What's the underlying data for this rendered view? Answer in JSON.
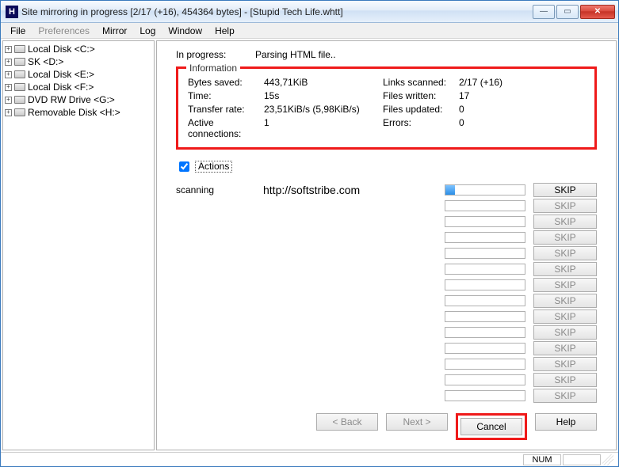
{
  "title": "Site mirroring in progress [2/17 (+16), 454364 bytes] - [Stupid Tech Life.whtt]",
  "app_icon_letter": "H",
  "menus": {
    "file": "File",
    "preferences": "Preferences",
    "mirror": "Mirror",
    "log": "Log",
    "window": "Window",
    "help": "Help"
  },
  "sidebar": {
    "items": [
      {
        "label": "Local Disk <C:>"
      },
      {
        "label": "SK <D:>"
      },
      {
        "label": "Local Disk <E:>"
      },
      {
        "label": "Local Disk <F:>"
      },
      {
        "label": "DVD RW Drive <G:>"
      },
      {
        "label": "Removable Disk <H:>"
      }
    ]
  },
  "progress": {
    "label": "In progress:",
    "value": "Parsing HTML file.."
  },
  "info": {
    "legend": "Information",
    "bytes_saved_label": "Bytes saved:",
    "bytes_saved": "443,71KiB",
    "time_label": "Time:",
    "time": "15s",
    "transfer_rate_label": "Transfer rate:",
    "transfer_rate": "23,51KiB/s (5,98KiB/s)",
    "active_conn_label": "Active connections:",
    "active_conn": "1",
    "links_scanned_label": "Links scanned:",
    "links_scanned": "2/17 (+16)",
    "files_written_label": "Files written:",
    "files_written": "17",
    "files_updated_label": "Files updated:",
    "files_updated": "0",
    "errors_label": "Errors:",
    "errors": "0"
  },
  "actions": {
    "label": "Actions",
    "checked": true
  },
  "transfer": {
    "rows": [
      {
        "status": "scanning",
        "url": "http://softstribe.com",
        "progress": 12,
        "skip_enabled": true
      },
      {
        "status": "",
        "url": "",
        "progress": 0,
        "skip_enabled": false
      },
      {
        "status": "",
        "url": "",
        "progress": 0,
        "skip_enabled": false
      },
      {
        "status": "",
        "url": "",
        "progress": 0,
        "skip_enabled": false
      },
      {
        "status": "",
        "url": "",
        "progress": 0,
        "skip_enabled": false
      },
      {
        "status": "",
        "url": "",
        "progress": 0,
        "skip_enabled": false
      },
      {
        "status": "",
        "url": "",
        "progress": 0,
        "skip_enabled": false
      },
      {
        "status": "",
        "url": "",
        "progress": 0,
        "skip_enabled": false
      },
      {
        "status": "",
        "url": "",
        "progress": 0,
        "skip_enabled": false
      },
      {
        "status": "",
        "url": "",
        "progress": 0,
        "skip_enabled": false
      },
      {
        "status": "",
        "url": "",
        "progress": 0,
        "skip_enabled": false
      },
      {
        "status": "",
        "url": "",
        "progress": 0,
        "skip_enabled": false
      },
      {
        "status": "",
        "url": "",
        "progress": 0,
        "skip_enabled": false
      },
      {
        "status": "",
        "url": "",
        "progress": 0,
        "skip_enabled": false
      }
    ],
    "skip_label": "SKIP"
  },
  "buttons": {
    "back": "< Back",
    "next": "Next >",
    "cancel": "Cancel",
    "help": "Help"
  },
  "statusbar": {
    "num": "NUM"
  }
}
